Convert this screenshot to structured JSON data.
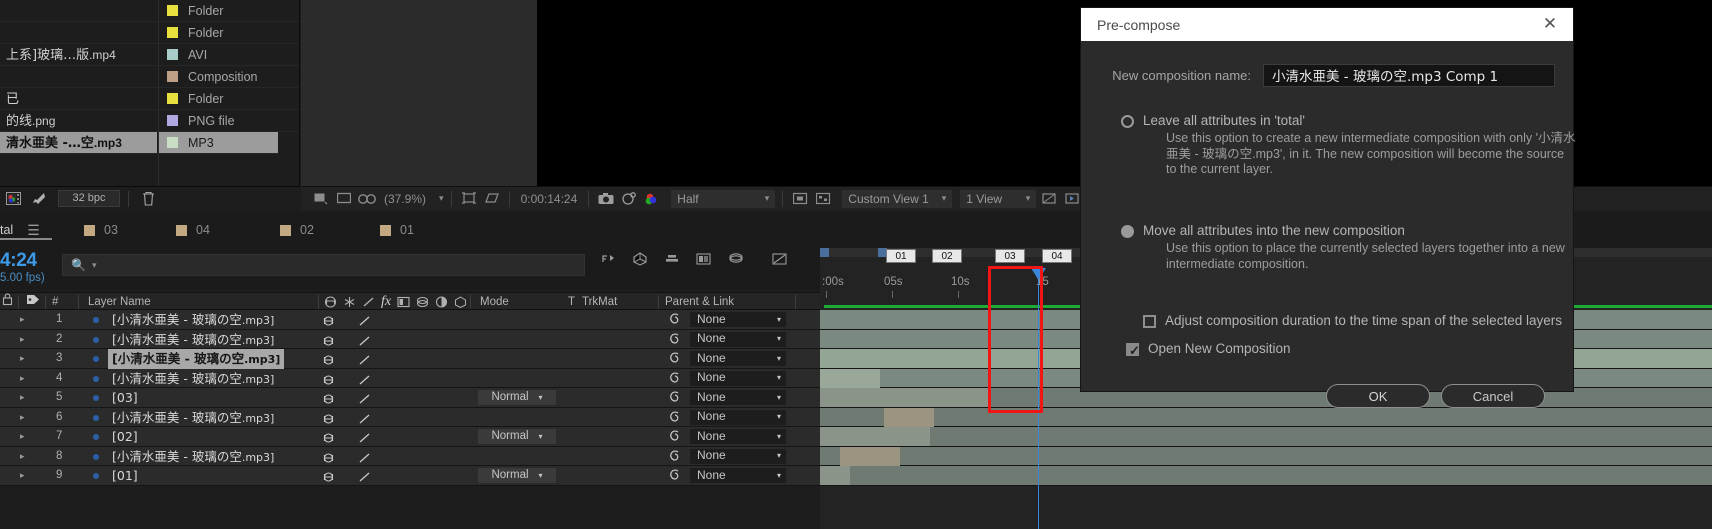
{
  "project_panel": {
    "rows": [
      {
        "name": "",
        "type": "Folder",
        "swatch": "#e8e03c",
        "selected": false
      },
      {
        "name": "",
        "type": "Folder",
        "swatch": "#e8e03c",
        "selected": false
      },
      {
        "name": "上系]玻璃…版",
        "ext": ".mp4",
        "type": "AVI",
        "swatch": "#a8ccc8",
        "selected": false
      },
      {
        "name": "",
        "type": "Composition",
        "swatch": "#bda085",
        "selected": false
      },
      {
        "name": "已",
        "ext": "",
        "type": "Folder",
        "swatch": "#e8e03c",
        "selected": false
      },
      {
        "name": "的线",
        "ext": ".png",
        "type": "PNG file",
        "swatch": "#b0a8e0",
        "selected": false
      },
      {
        "name": "清水亜美 -…空",
        "ext": ".mp3",
        "type": "MP3",
        "swatch": "#c8ddc4",
        "selected": true
      }
    ]
  },
  "project_toolbar": {
    "icons": [
      "project-color-icon",
      "render-rocket-icon"
    ],
    "bit_depth": "32 bpc",
    "trash_icon": "trash-icon"
  },
  "viewer_toolbar": {
    "icons_left": [
      "toggle-view-icon",
      "monitor-icon",
      "3d-glasses-icon"
    ],
    "zoom_level": "(37.9%)",
    "icons_mid": [
      "region-of-interest-icon",
      "grid-guides-icon"
    ],
    "timecode": "0:00:14:24",
    "icons_mid2": [
      "snapshot-icon",
      "show-snapshot-icon",
      "channels-icon"
    ],
    "resolution": "Half",
    "icons_right": [
      "region-icon",
      "transparency-grid-icon"
    ],
    "view_layout": "Custom View 1",
    "views": "1 View",
    "icons_far": [
      "pixel-aspect-icon",
      "fast-preview-icon",
      "timeline-icon"
    ]
  },
  "timeline_tabs": [
    {
      "label": "tal",
      "active": true
    },
    {
      "label": "03",
      "active": false
    },
    {
      "label": "04",
      "active": false
    },
    {
      "label": "02",
      "active": false
    },
    {
      "label": "01",
      "active": false
    }
  ],
  "timeline_header": {
    "current_time": "4:24",
    "fps": "5.00 fps)",
    "search_placeholder": "",
    "search_icon": "search-icon",
    "toggle_icons": [
      "shy-icon",
      "enable-frame-blend-icon",
      "motion-blur-icon",
      "graph-editor-icon",
      "draft-3d-icon"
    ]
  },
  "column_headers": {
    "lock_icon": "lock-icon",
    "label_icon": "label-tag-icon",
    "number": "#",
    "layer_name": "Layer Name",
    "switch_icons": [
      "audio-icon",
      "solo-icon",
      "lock-layer-icon",
      "fx-icon",
      "adjustment-icon",
      "collapse-icon",
      "quality-icon",
      "3d-icon"
    ],
    "mode": "Mode",
    "t": "T",
    "trkmat": "TrkMat",
    "parent": "Parent & Link"
  },
  "layers": [
    {
      "num": "1",
      "name": "[小清水亜美 - 玻璃の空",
      "ext": ".mp3]",
      "mode": "",
      "parent": "None",
      "selected": false
    },
    {
      "num": "2",
      "name": "[小清水亜美 - 玻璃の空",
      "ext": ".mp3]",
      "mode": "",
      "parent": "None",
      "selected": false
    },
    {
      "num": "3",
      "name": "[小清水亜美 - 玻璃の空",
      "ext": ".mp3]",
      "mode": "",
      "parent": "None",
      "selected": true
    },
    {
      "num": "4",
      "name": "[小清水亜美 - 玻璃の空",
      "ext": ".mp3]",
      "mode": "",
      "parent": "None",
      "selected": false
    },
    {
      "num": "5",
      "name": "[03]",
      "ext": "",
      "mode": "Normal",
      "parent": "None",
      "selected": false
    },
    {
      "num": "6",
      "name": "[小清水亜美 - 玻璃の空",
      "ext": ".mp3]",
      "mode": "",
      "parent": "None",
      "selected": false
    },
    {
      "num": "7",
      "name": "[02]",
      "ext": "",
      "mode": "Normal",
      "parent": "None",
      "selected": false
    },
    {
      "num": "8",
      "name": "[小清水亜美 - 玻璃の空",
      "ext": ".mp3]",
      "mode": "",
      "parent": "None",
      "selected": false
    },
    {
      "num": "9",
      "name": "[01]",
      "ext": "",
      "mode": "Normal",
      "parent": "None",
      "selected": false
    }
  ],
  "timeline_ruler": {
    "ticks": [
      ":00s",
      "05s",
      "10s"
    ],
    "markers": [
      "01",
      "02",
      "03",
      "04"
    ],
    "playhead_label": "15"
  },
  "dialog": {
    "title": "Pre-compose",
    "close_icon": "close-icon",
    "name_label": "New composition name:",
    "name_value": "小清水亜美 - 玻璃の空.mp3 Comp 1",
    "option_leave": {
      "title": "Leave all attributes in 'total'",
      "desc": "Use this option to create a new intermediate composition with only '小清水亜美 - 玻璃の空.mp3', in it. The new composition will become the source to the current layer.",
      "selected": false
    },
    "option_move": {
      "title": "Move all attributes into the new composition",
      "desc": "Use this option to place the currently selected layers together into a new intermediate composition.",
      "selected": true
    },
    "checkbox_adjust": {
      "label": "Adjust composition duration to the time span of the selected layers",
      "checked": false
    },
    "checkbox_open": {
      "label": "Open New Composition",
      "checked": true
    },
    "ok_label": "OK",
    "cancel_label": "Cancel"
  },
  "colors": {
    "accent_blue": "#3d9ae8",
    "selection_red": "#f01616",
    "work_green": "#1faa38",
    "dialog_bg": "#2b2b2b"
  }
}
